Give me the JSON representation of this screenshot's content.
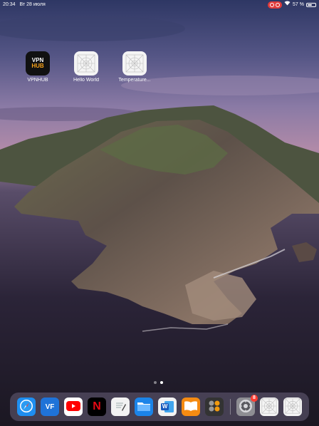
{
  "status_bar": {
    "time": "20:34",
    "date": "Вт 28 июля",
    "battery_text": "57 %",
    "battery_level": 0.57
  },
  "home_apps": [
    {
      "label": "VPNHUB",
      "icon": "vpnhub-icon",
      "tile_line1": "VPN",
      "tile_line2": "HUB"
    },
    {
      "label": "Hello World",
      "icon": "blank-app-icon"
    },
    {
      "label": "Temperature...",
      "icon": "blank-app-icon"
    }
  ],
  "page_indicator": {
    "count": 2,
    "active": 1
  },
  "dock": {
    "apps": [
      {
        "name": "safari",
        "icon": "compass-icon",
        "color": "#1e8ef0"
      },
      {
        "name": "vf",
        "icon": "vf-icon",
        "color": "#1f73d8",
        "glyph": "VF"
      },
      {
        "name": "youtube",
        "icon": "youtube-icon",
        "color": "#ffffff"
      },
      {
        "name": "netflix",
        "icon": "netflix-icon",
        "color": "#000000",
        "glyph": "N"
      },
      {
        "name": "notes-editor",
        "icon": "pen-icon",
        "color": "#f2f2f2"
      },
      {
        "name": "files",
        "icon": "folder-icon",
        "color": "#1b84e8"
      },
      {
        "name": "word",
        "icon": "word-icon",
        "color": "#f2f2f2",
        "glyph": "W"
      },
      {
        "name": "books",
        "icon": "book-icon",
        "color": "#f58b12"
      },
      {
        "name": "calculator",
        "icon": "calculator-icon",
        "color": "#333333"
      }
    ],
    "recent_apps": [
      {
        "name": "settings",
        "icon": "gear-icon",
        "color": "#8e8e93",
        "badge": "8"
      },
      {
        "name": "app-blank-1",
        "icon": "blank-app-icon",
        "color": "#f4f4f4"
      },
      {
        "name": "app-blank-2",
        "icon": "blank-app-icon",
        "color": "#f4f4f4"
      }
    ]
  }
}
